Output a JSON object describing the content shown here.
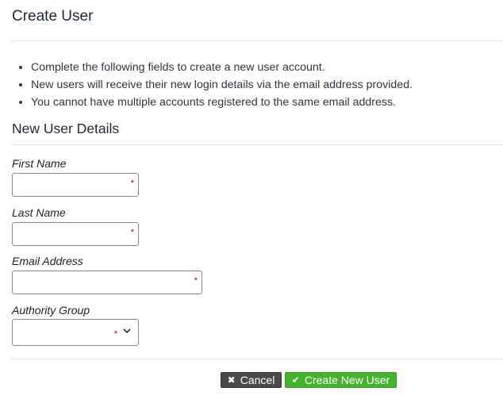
{
  "page": {
    "title": "Create User"
  },
  "info": {
    "items": [
      "Complete the following fields to create a new user account.",
      "New users will receive their new login details via the email address provided.",
      "You cannot have multiple accounts registered to the same email address."
    ]
  },
  "section": {
    "title": "New User Details"
  },
  "form": {
    "first_name": {
      "label": "First Name",
      "value": "",
      "required_mark": "*"
    },
    "last_name": {
      "label": "Last Name",
      "value": "",
      "required_mark": "*"
    },
    "email": {
      "label": "Email Address",
      "value": "",
      "required_mark": "*"
    },
    "authority_group": {
      "label": "Authority Group",
      "value": "",
      "required_mark": "*"
    }
  },
  "actions": {
    "cancel_label": "Cancel",
    "cancel_icon": "times-icon",
    "create_label": "Create New User",
    "create_icon": "check-icon"
  },
  "colors": {
    "cancel_bg": "#4a4a4a",
    "create_bg": "#44b32e",
    "required": "#b00000"
  }
}
